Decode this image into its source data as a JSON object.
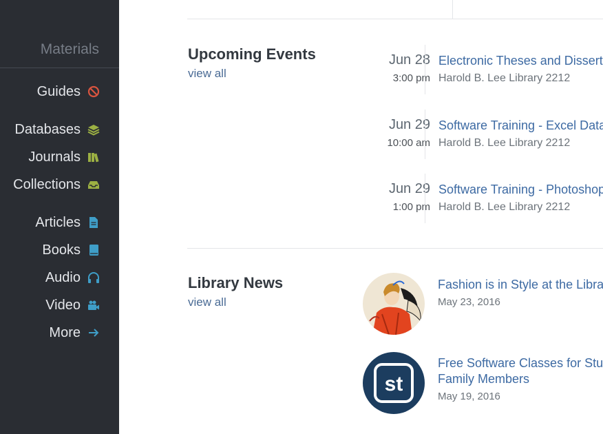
{
  "sidebar": {
    "heading": "Materials",
    "items": [
      {
        "label": "Guides",
        "icon": "no-entry-icon",
        "color": "#d9543f"
      },
      {
        "label": "Databases",
        "icon": "layers-icon",
        "color": "#9cb043"
      },
      {
        "label": "Journals",
        "icon": "books-icon",
        "color": "#9cb043"
      },
      {
        "label": "Collections",
        "icon": "inbox-icon",
        "color": "#9cb043"
      },
      {
        "label": "Articles",
        "icon": "document-icon",
        "color": "#3f9ec8"
      },
      {
        "label": "Books",
        "icon": "book-icon",
        "color": "#3f9ec8"
      },
      {
        "label": "Audio",
        "icon": "headphones-icon",
        "color": "#3f9ec8"
      },
      {
        "label": "Video",
        "icon": "video-camera-icon",
        "color": "#3f9ec8"
      },
      {
        "label": "More",
        "icon": "arrow-right-icon",
        "color": "#3f9ec8"
      }
    ]
  },
  "events": {
    "title": "Upcoming Events",
    "view_all": "view all",
    "items": [
      {
        "date": "Jun 28",
        "time": "3:00 pm",
        "title": "Electronic Theses and Disserta",
        "location": "Harold B. Lee Library 2212"
      },
      {
        "date": "Jun 29",
        "time": "10:00 am",
        "title": "Software Training - Excel Data",
        "location": "Harold B. Lee Library 2212"
      },
      {
        "date": "Jun 29",
        "time": "1:00 pm",
        "title": "Software Training - Photoshop",
        "location": "Harold B. Lee Library 2212"
      }
    ]
  },
  "news": {
    "title": "Library News",
    "view_all": "view all",
    "items": [
      {
        "title_lines": [
          "Fashion is in Style at the Librar"
        ],
        "date": "May 23, 2016",
        "image": "fashion-illustration"
      },
      {
        "title_lines": [
          "Free Software Classes for Stude",
          "Family Members"
        ],
        "date": "May 19, 2016",
        "image": "st-logo",
        "logo_text": "st"
      }
    ]
  },
  "colors": {
    "sidebar_bg": "#2a2d33",
    "link": "#3d6aa3",
    "heading": "#333940"
  }
}
